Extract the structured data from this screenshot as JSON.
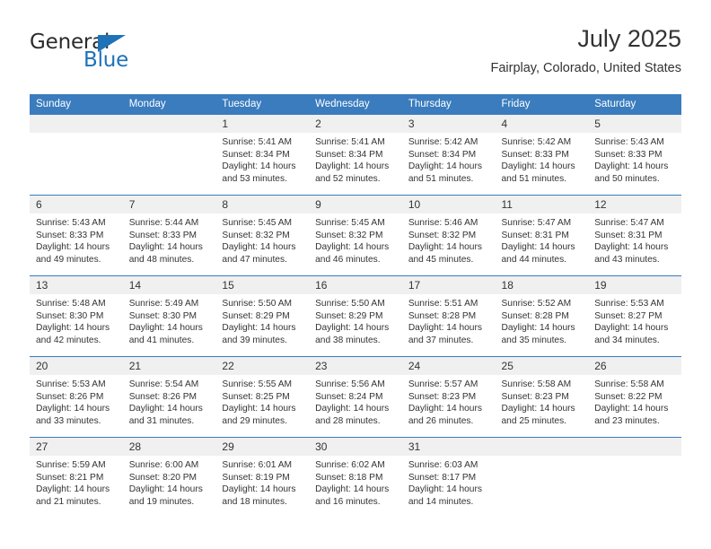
{
  "brand": {
    "name_part1": "General",
    "name_part2": "Blue",
    "triangle_color": "#1d72b8",
    "text_color": "#2b2b2b"
  },
  "header": {
    "title": "July 2025",
    "subtitle": "Fairplay, Colorado, United States"
  },
  "theme": {
    "header_blue": "#3a7cbe",
    "daynum_background": "#f0f0f0",
    "text": "#333333",
    "rule": "#3a7cbe"
  },
  "weekdays": [
    "Sunday",
    "Monday",
    "Tuesday",
    "Wednesday",
    "Thursday",
    "Friday",
    "Saturday"
  ],
  "labels": {
    "sunrise_prefix": "Sunrise:",
    "sunset_prefix": "Sunset:",
    "daylight_prefix": "Daylight:"
  },
  "weeks": [
    [
      {
        "day": "",
        "empty": true
      },
      {
        "day": "",
        "empty": true
      },
      {
        "day": "1",
        "sunrise": "Sunrise: 5:41 AM",
        "sunset": "Sunset: 8:34 PM",
        "daylight_line1": "Daylight: 14 hours",
        "daylight_line2": "and 53 minutes."
      },
      {
        "day": "2",
        "sunrise": "Sunrise: 5:41 AM",
        "sunset": "Sunset: 8:34 PM",
        "daylight_line1": "Daylight: 14 hours",
        "daylight_line2": "and 52 minutes."
      },
      {
        "day": "3",
        "sunrise": "Sunrise: 5:42 AM",
        "sunset": "Sunset: 8:34 PM",
        "daylight_line1": "Daylight: 14 hours",
        "daylight_line2": "and 51 minutes."
      },
      {
        "day": "4",
        "sunrise": "Sunrise: 5:42 AM",
        "sunset": "Sunset: 8:33 PM",
        "daylight_line1": "Daylight: 14 hours",
        "daylight_line2": "and 51 minutes."
      },
      {
        "day": "5",
        "sunrise": "Sunrise: 5:43 AM",
        "sunset": "Sunset: 8:33 PM",
        "daylight_line1": "Daylight: 14 hours",
        "daylight_line2": "and 50 minutes."
      }
    ],
    [
      {
        "day": "6",
        "sunrise": "Sunrise: 5:43 AM",
        "sunset": "Sunset: 8:33 PM",
        "daylight_line1": "Daylight: 14 hours",
        "daylight_line2": "and 49 minutes."
      },
      {
        "day": "7",
        "sunrise": "Sunrise: 5:44 AM",
        "sunset": "Sunset: 8:33 PM",
        "daylight_line1": "Daylight: 14 hours",
        "daylight_line2": "and 48 minutes."
      },
      {
        "day": "8",
        "sunrise": "Sunrise: 5:45 AM",
        "sunset": "Sunset: 8:32 PM",
        "daylight_line1": "Daylight: 14 hours",
        "daylight_line2": "and 47 minutes."
      },
      {
        "day": "9",
        "sunrise": "Sunrise: 5:45 AM",
        "sunset": "Sunset: 8:32 PM",
        "daylight_line1": "Daylight: 14 hours",
        "daylight_line2": "and 46 minutes."
      },
      {
        "day": "10",
        "sunrise": "Sunrise: 5:46 AM",
        "sunset": "Sunset: 8:32 PM",
        "daylight_line1": "Daylight: 14 hours",
        "daylight_line2": "and 45 minutes."
      },
      {
        "day": "11",
        "sunrise": "Sunrise: 5:47 AM",
        "sunset": "Sunset: 8:31 PM",
        "daylight_line1": "Daylight: 14 hours",
        "daylight_line2": "and 44 minutes."
      },
      {
        "day": "12",
        "sunrise": "Sunrise: 5:47 AM",
        "sunset": "Sunset: 8:31 PM",
        "daylight_line1": "Daylight: 14 hours",
        "daylight_line2": "and 43 minutes."
      }
    ],
    [
      {
        "day": "13",
        "sunrise": "Sunrise: 5:48 AM",
        "sunset": "Sunset: 8:30 PM",
        "daylight_line1": "Daylight: 14 hours",
        "daylight_line2": "and 42 minutes."
      },
      {
        "day": "14",
        "sunrise": "Sunrise: 5:49 AM",
        "sunset": "Sunset: 8:30 PM",
        "daylight_line1": "Daylight: 14 hours",
        "daylight_line2": "and 41 minutes."
      },
      {
        "day": "15",
        "sunrise": "Sunrise: 5:50 AM",
        "sunset": "Sunset: 8:29 PM",
        "daylight_line1": "Daylight: 14 hours",
        "daylight_line2": "and 39 minutes."
      },
      {
        "day": "16",
        "sunrise": "Sunrise: 5:50 AM",
        "sunset": "Sunset: 8:29 PM",
        "daylight_line1": "Daylight: 14 hours",
        "daylight_line2": "and 38 minutes."
      },
      {
        "day": "17",
        "sunrise": "Sunrise: 5:51 AM",
        "sunset": "Sunset: 8:28 PM",
        "daylight_line1": "Daylight: 14 hours",
        "daylight_line2": "and 37 minutes."
      },
      {
        "day": "18",
        "sunrise": "Sunrise: 5:52 AM",
        "sunset": "Sunset: 8:28 PM",
        "daylight_line1": "Daylight: 14 hours",
        "daylight_line2": "and 35 minutes."
      },
      {
        "day": "19",
        "sunrise": "Sunrise: 5:53 AM",
        "sunset": "Sunset: 8:27 PM",
        "daylight_line1": "Daylight: 14 hours",
        "daylight_line2": "and 34 minutes."
      }
    ],
    [
      {
        "day": "20",
        "sunrise": "Sunrise: 5:53 AM",
        "sunset": "Sunset: 8:26 PM",
        "daylight_line1": "Daylight: 14 hours",
        "daylight_line2": "and 33 minutes."
      },
      {
        "day": "21",
        "sunrise": "Sunrise: 5:54 AM",
        "sunset": "Sunset: 8:26 PM",
        "daylight_line1": "Daylight: 14 hours",
        "daylight_line2": "and 31 minutes."
      },
      {
        "day": "22",
        "sunrise": "Sunrise: 5:55 AM",
        "sunset": "Sunset: 8:25 PM",
        "daylight_line1": "Daylight: 14 hours",
        "daylight_line2": "and 29 minutes."
      },
      {
        "day": "23",
        "sunrise": "Sunrise: 5:56 AM",
        "sunset": "Sunset: 8:24 PM",
        "daylight_line1": "Daylight: 14 hours",
        "daylight_line2": "and 28 minutes."
      },
      {
        "day": "24",
        "sunrise": "Sunrise: 5:57 AM",
        "sunset": "Sunset: 8:23 PM",
        "daylight_line1": "Daylight: 14 hours",
        "daylight_line2": "and 26 minutes."
      },
      {
        "day": "25",
        "sunrise": "Sunrise: 5:58 AM",
        "sunset": "Sunset: 8:23 PM",
        "daylight_line1": "Daylight: 14 hours",
        "daylight_line2": "and 25 minutes."
      },
      {
        "day": "26",
        "sunrise": "Sunrise: 5:58 AM",
        "sunset": "Sunset: 8:22 PM",
        "daylight_line1": "Daylight: 14 hours",
        "daylight_line2": "and 23 minutes."
      }
    ],
    [
      {
        "day": "27",
        "sunrise": "Sunrise: 5:59 AM",
        "sunset": "Sunset: 8:21 PM",
        "daylight_line1": "Daylight: 14 hours",
        "daylight_line2": "and 21 minutes."
      },
      {
        "day": "28",
        "sunrise": "Sunrise: 6:00 AM",
        "sunset": "Sunset: 8:20 PM",
        "daylight_line1": "Daylight: 14 hours",
        "daylight_line2": "and 19 minutes."
      },
      {
        "day": "29",
        "sunrise": "Sunrise: 6:01 AM",
        "sunset": "Sunset: 8:19 PM",
        "daylight_line1": "Daylight: 14 hours",
        "daylight_line2": "and 18 minutes."
      },
      {
        "day": "30",
        "sunrise": "Sunrise: 6:02 AM",
        "sunset": "Sunset: 8:18 PM",
        "daylight_line1": "Daylight: 14 hours",
        "daylight_line2": "and 16 minutes."
      },
      {
        "day": "31",
        "sunrise": "Sunrise: 6:03 AM",
        "sunset": "Sunset: 8:17 PM",
        "daylight_line1": "Daylight: 14 hours",
        "daylight_line2": "and 14 minutes."
      },
      {
        "day": "",
        "empty": true
      },
      {
        "day": "",
        "empty": true
      }
    ]
  ]
}
